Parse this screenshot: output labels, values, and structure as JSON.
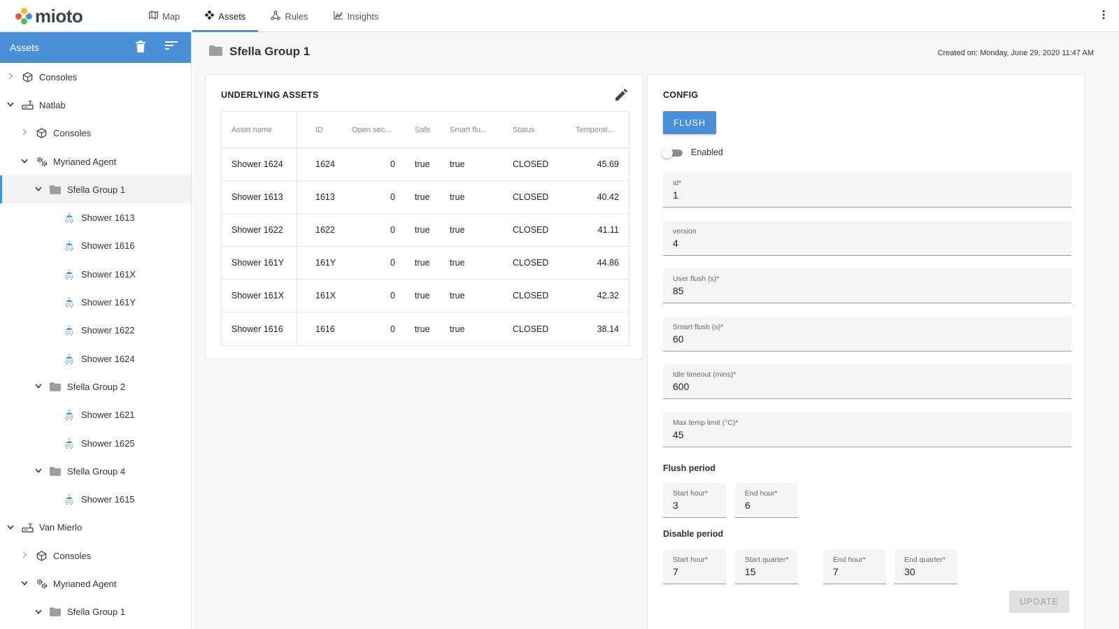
{
  "brand": {
    "name": "mioto",
    "dot_colors": [
      "#e8563f",
      "#f5b82e",
      "#4a90d9",
      "#5cb85c"
    ]
  },
  "nav": {
    "items": [
      {
        "label": "Map",
        "icon": "map-icon",
        "active": false
      },
      {
        "label": "Assets",
        "icon": "assets-icon",
        "active": true
      },
      {
        "label": "Rules",
        "icon": "rules-icon",
        "active": false
      },
      {
        "label": "Insights",
        "icon": "insights-icon",
        "active": false
      }
    ]
  },
  "sidebar": {
    "title": "Assets",
    "items": [
      {
        "label": "Consoles",
        "icon": "cube-icon",
        "depth": 0,
        "expand": "collapsed"
      },
      {
        "label": "Natlab",
        "icon": "router-icon",
        "depth": 0,
        "expand": "expanded"
      },
      {
        "label": "Consoles",
        "icon": "cube-icon",
        "depth": 1,
        "expand": "collapsed"
      },
      {
        "label": "Myrianed Agent",
        "icon": "gears-icon",
        "depth": 1,
        "expand": "expanded"
      },
      {
        "label": "Sfella Group 1",
        "icon": "folder-icon",
        "depth": 2,
        "expand": "expanded",
        "selected": true
      },
      {
        "label": "Shower 1613",
        "icon": "shower-icon",
        "depth": 3,
        "expand": "none"
      },
      {
        "label": "Shower 1616",
        "icon": "shower-icon",
        "depth": 3,
        "expand": "none"
      },
      {
        "label": "Shower 161X",
        "icon": "shower-icon",
        "depth": 3,
        "expand": "none"
      },
      {
        "label": "Shower 161Y",
        "icon": "shower-icon",
        "depth": 3,
        "expand": "none"
      },
      {
        "label": "Shower 1622",
        "icon": "shower-icon",
        "depth": 3,
        "expand": "none"
      },
      {
        "label": "Shower 1624",
        "icon": "shower-icon",
        "depth": 3,
        "expand": "none"
      },
      {
        "label": "Sfella Group 2",
        "icon": "folder-icon",
        "depth": 2,
        "expand": "expanded"
      },
      {
        "label": "Shower 1621",
        "icon": "shower-icon",
        "depth": 3,
        "expand": "none"
      },
      {
        "label": "Shower 1625",
        "icon": "shower-icon",
        "depth": 3,
        "expand": "none"
      },
      {
        "label": "Sfella Group 4",
        "icon": "folder-icon",
        "depth": 2,
        "expand": "expanded"
      },
      {
        "label": "Shower 1615",
        "icon": "shower-icon",
        "depth": 3,
        "expand": "none"
      },
      {
        "label": "Van Mierlo",
        "icon": "router-icon",
        "depth": 0,
        "expand": "expanded"
      },
      {
        "label": "Consoles",
        "icon": "cube-icon",
        "depth": 1,
        "expand": "collapsed"
      },
      {
        "label": "Myrianed Agent",
        "icon": "gears-icon",
        "depth": 1,
        "expand": "expanded"
      },
      {
        "label": "Sfella Group 1",
        "icon": "folder-icon",
        "depth": 2,
        "expand": "expanded"
      }
    ]
  },
  "page": {
    "title": "Sfella Group 1",
    "created": "Created on: Monday, June 29, 2020 11:47 AM"
  },
  "underlying": {
    "title": "UNDERLYING ASSETS",
    "columns": [
      "Asset name",
      "ID",
      "Open sec...",
      "Safe",
      "Smart flu...",
      "Status",
      "Temperat..."
    ],
    "rows": [
      [
        "Shower 1624",
        "1624",
        "0",
        "true",
        "true",
        "CLOSED",
        "45.69"
      ],
      [
        "Shower 1613",
        "1613",
        "0",
        "true",
        "true",
        "CLOSED",
        "40.42"
      ],
      [
        "Shower 1622",
        "1622",
        "0",
        "true",
        "true",
        "CLOSED",
        "41.11"
      ],
      [
        "Shower 161Y",
        "161Y",
        "0",
        "true",
        "true",
        "CLOSED",
        "44.86"
      ],
      [
        "Shower 161X",
        "161X",
        "0",
        "true",
        "true",
        "CLOSED",
        "42.32"
      ],
      [
        "Shower 1616",
        "1616",
        "0",
        "true",
        "true",
        "CLOSED",
        "38.14"
      ]
    ]
  },
  "config": {
    "title": "CONFIG",
    "flush_label": "FLUSH",
    "enabled_label": "Enabled",
    "enabled": false,
    "fields": [
      {
        "label": "id*",
        "value": "1"
      },
      {
        "label": "version",
        "value": "4"
      },
      {
        "label": "User flush (s)*",
        "value": "85"
      },
      {
        "label": "Smart flush (s)*",
        "value": "60"
      },
      {
        "label": "Idle timeout (mins)*",
        "value": "600"
      },
      {
        "label": "Max temp limit (°C)*",
        "value": "45"
      }
    ],
    "flush_period": {
      "title": "Flush period",
      "fields": [
        {
          "label": "Start hour*",
          "value": "3"
        },
        {
          "label": "End hour*",
          "value": "6"
        }
      ]
    },
    "disable_period": {
      "title": "Disable period",
      "fields": [
        {
          "label": "Start hour*",
          "value": "7"
        },
        {
          "label": "Start quarter*",
          "value": "15"
        },
        {
          "label": "End hour*",
          "value": "7"
        },
        {
          "label": "End quarter*",
          "value": "30"
        }
      ]
    },
    "update_label": "UPDATE"
  }
}
